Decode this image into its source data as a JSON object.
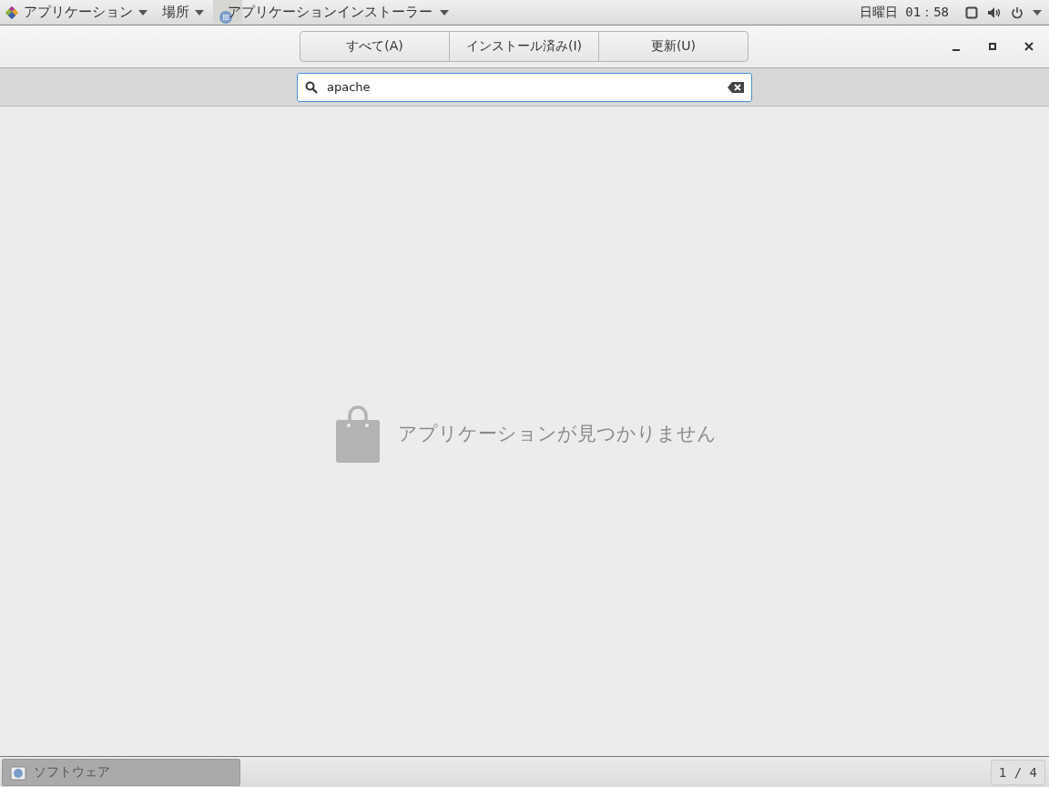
{
  "top_bar": {
    "applications_menu": "アプリケーション",
    "places_menu": "場所",
    "window_menu": "アプリケーションインストーラー",
    "clock": "日曜日 01：58"
  },
  "header": {
    "tabs": [
      {
        "label": "すべて(A)",
        "selected": false
      },
      {
        "label": "インストール済み(I)",
        "selected": false
      },
      {
        "label": "更新(U)",
        "selected": false
      }
    ]
  },
  "search": {
    "value": "apache"
  },
  "empty_state": {
    "message": "アプリケーションが見つかりません"
  },
  "taskbar": {
    "windows": [
      {
        "label": "ソフトウェア",
        "selected": true
      }
    ],
    "workspace": "1 / 4"
  }
}
